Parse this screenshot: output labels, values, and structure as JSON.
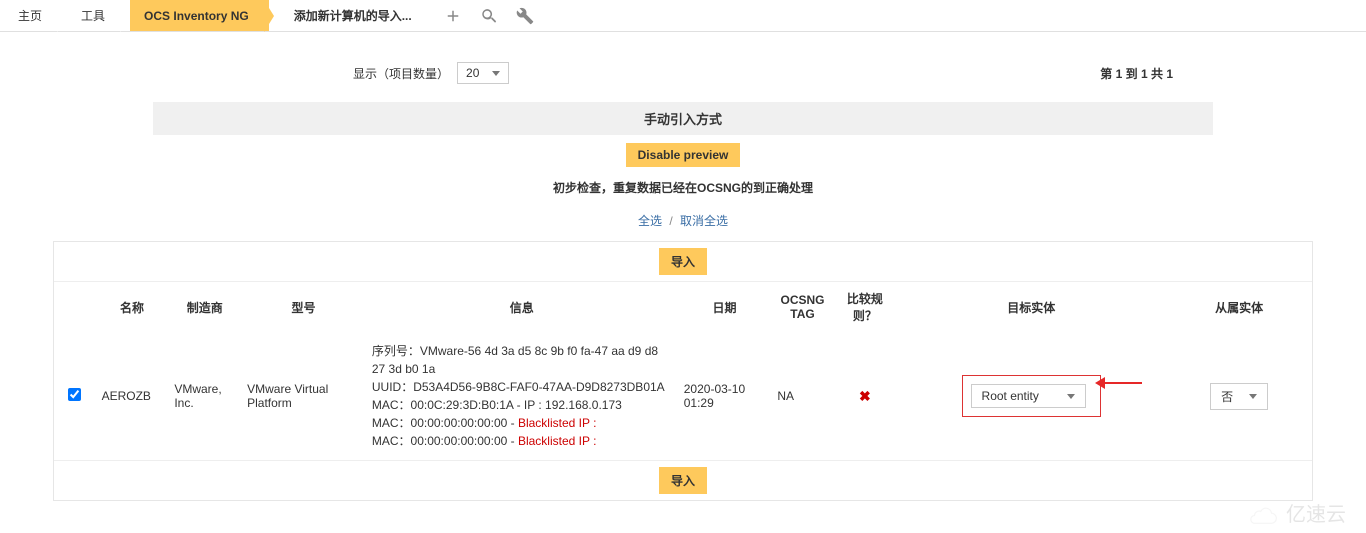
{
  "breadcrumb": {
    "home": "主页",
    "tools": "工具",
    "active": "OCS Inventory NG",
    "sub": "添加新计算机的导入..."
  },
  "controls": {
    "display_label": "显示（项目数量）",
    "display_value": "20",
    "pager": "第 1 到 1 共 1"
  },
  "sections": {
    "manual_title": "手动引入方式",
    "disable_preview": "Disable preview",
    "check_note": "初步检查，重复数据已经在OCSNG的到正确处理",
    "select_all": "全选",
    "deselect_all": "取消全选",
    "import_btn": "导入"
  },
  "table": {
    "headers": {
      "name": "名称",
      "manufacturer": "制造商",
      "model": "型号",
      "info": "信息",
      "date": "日期",
      "ocsng_tag": "OCSNG TAG",
      "compare_rule": "比较规则？",
      "target_entity": "目标实体",
      "sub_entity": "从属实体"
    },
    "row": {
      "checked": true,
      "name": "AEROZB",
      "manufacturer": "VMware, Inc.",
      "model": "VMware Virtual Platform",
      "info_serial_label": "序列号：",
      "info_serial": "VMware-56 4d 3a d5 8c 9b f0 fa-47 aa d9 d8 27 3d b0 1a",
      "info_uuid_label": "UUID：",
      "info_uuid": "D53A4D56-9B8C-FAF0-47AA-D9D8273DB01A",
      "info_mac1_label": "MAC：",
      "info_mac1": "00:0C:29:3D:B0:1A - IP : 192.168.0.173",
      "info_mac2_label": "MAC：",
      "info_mac2": "00:00:00:00:00:00 - ",
      "info_mac3_label": "MAC：",
      "info_mac3": "00:00:00:00:00:00 - ",
      "blacklisted": "Blacklisted IP :",
      "date": "2020-03-10 01:29",
      "ocsng_tag": "NA",
      "target_entity_value": "Root entity",
      "sub_entity_value": "否"
    }
  },
  "watermark": "亿速云"
}
